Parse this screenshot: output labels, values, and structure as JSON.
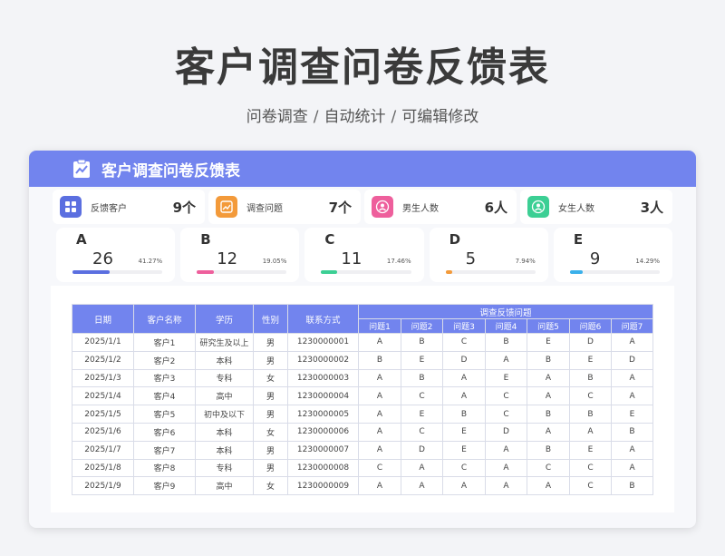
{
  "title": "客户调查问卷反馈表",
  "subtitle": {
    "part1": "问卷调查",
    "part2": "自动统计",
    "part3": "可编辑修改",
    "sep": "/"
  },
  "panel": {
    "header_title": "客户调查问卷反馈表"
  },
  "stats": [
    {
      "label": "反馈客户",
      "value": "9个",
      "icon": "grid-icon",
      "color": "#5b6fe0"
    },
    {
      "label": "调查问题",
      "value": "7个",
      "icon": "trend-icon",
      "color": "#f39a3a"
    },
    {
      "label": "男生人数",
      "value": "6人",
      "icon": "user-icon",
      "color": "#ee5f9c"
    },
    {
      "label": "女生人数",
      "value": "3人",
      "icon": "user-icon",
      "color": "#3ccf94"
    }
  ],
  "grades": [
    {
      "letter": "A",
      "count": "26",
      "percent": "41.27%",
      "ratio": 0.4127,
      "color": "#5b6fe0"
    },
    {
      "letter": "B",
      "count": "12",
      "percent": "19.05%",
      "ratio": 0.1905,
      "color": "#ee5f9c"
    },
    {
      "letter": "C",
      "count": "11",
      "percent": "17.46%",
      "ratio": 0.1746,
      "color": "#3ccf94"
    },
    {
      "letter": "D",
      "count": "5",
      "percent": "7.94%",
      "ratio": 0.0794,
      "color": "#f39a3a"
    },
    {
      "letter": "E",
      "count": "9",
      "percent": "14.29%",
      "ratio": 0.1429,
      "color": "#3ab0ea"
    }
  ],
  "table": {
    "headers": [
      "日期",
      "客户名称",
      "学历",
      "性别",
      "联系方式"
    ],
    "group_header": "调查反馈问题",
    "questions": [
      "问题1",
      "问题2",
      "问题3",
      "问题4",
      "问题5",
      "问题6",
      "问题7"
    ],
    "rows": [
      [
        "2025/1/1",
        "客户1",
        "研究生及以上",
        "男",
        "1230000001",
        "A",
        "B",
        "C",
        "B",
        "E",
        "D",
        "A"
      ],
      [
        "2025/1/2",
        "客户2",
        "本科",
        "男",
        "1230000002",
        "B",
        "E",
        "D",
        "A",
        "B",
        "E",
        "D"
      ],
      [
        "2025/1/3",
        "客户3",
        "专科",
        "女",
        "1230000003",
        "A",
        "B",
        "A",
        "E",
        "A",
        "B",
        "A"
      ],
      [
        "2025/1/4",
        "客户4",
        "高中",
        "男",
        "1230000004",
        "A",
        "C",
        "A",
        "C",
        "A",
        "C",
        "A"
      ],
      [
        "2025/1/5",
        "客户5",
        "初中及以下",
        "男",
        "1230000005",
        "A",
        "E",
        "B",
        "C",
        "B",
        "B",
        "E"
      ],
      [
        "2025/1/6",
        "客户6",
        "本科",
        "女",
        "1230000006",
        "A",
        "C",
        "E",
        "D",
        "A",
        "A",
        "B"
      ],
      [
        "2025/1/7",
        "客户7",
        "本科",
        "男",
        "1230000007",
        "A",
        "D",
        "E",
        "A",
        "B",
        "E",
        "A"
      ],
      [
        "2025/1/8",
        "客户8",
        "专科",
        "男",
        "1230000008",
        "C",
        "A",
        "C",
        "A",
        "C",
        "C",
        "A"
      ],
      [
        "2025/1/9",
        "客户9",
        "高中",
        "女",
        "1230000009",
        "A",
        "A",
        "A",
        "A",
        "A",
        "C",
        "B"
      ]
    ]
  }
}
